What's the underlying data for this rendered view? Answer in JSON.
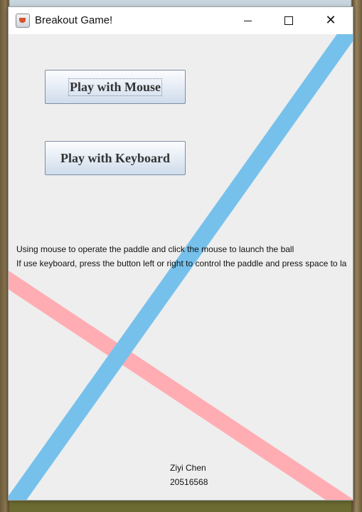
{
  "window": {
    "title": "Breakout Game!",
    "minimize_glyph": "minimize",
    "maximize_glyph": "maximize",
    "close_glyph": "✕"
  },
  "buttons": {
    "mouse_label": "Play with Mouse",
    "keyboard_label": "Play with Keyboard"
  },
  "instructions": {
    "mouse": "Using mouse to operate the paddle and click the mouse to launch the ball",
    "keyboard": "If use keyboard, press the button left or right to control the paddle and press space to la"
  },
  "author": {
    "name": "Ziyi Chen",
    "id": "20516568"
  },
  "colors": {
    "blue_stripe": "#76c1ec",
    "pink_stripe": "#ffadb3",
    "window_bg": "#eeeeee"
  },
  "icons": {
    "app": "java-coffee-cup-icon",
    "minimize": "minimize-icon",
    "maximize": "maximize-icon",
    "close": "close-icon"
  }
}
